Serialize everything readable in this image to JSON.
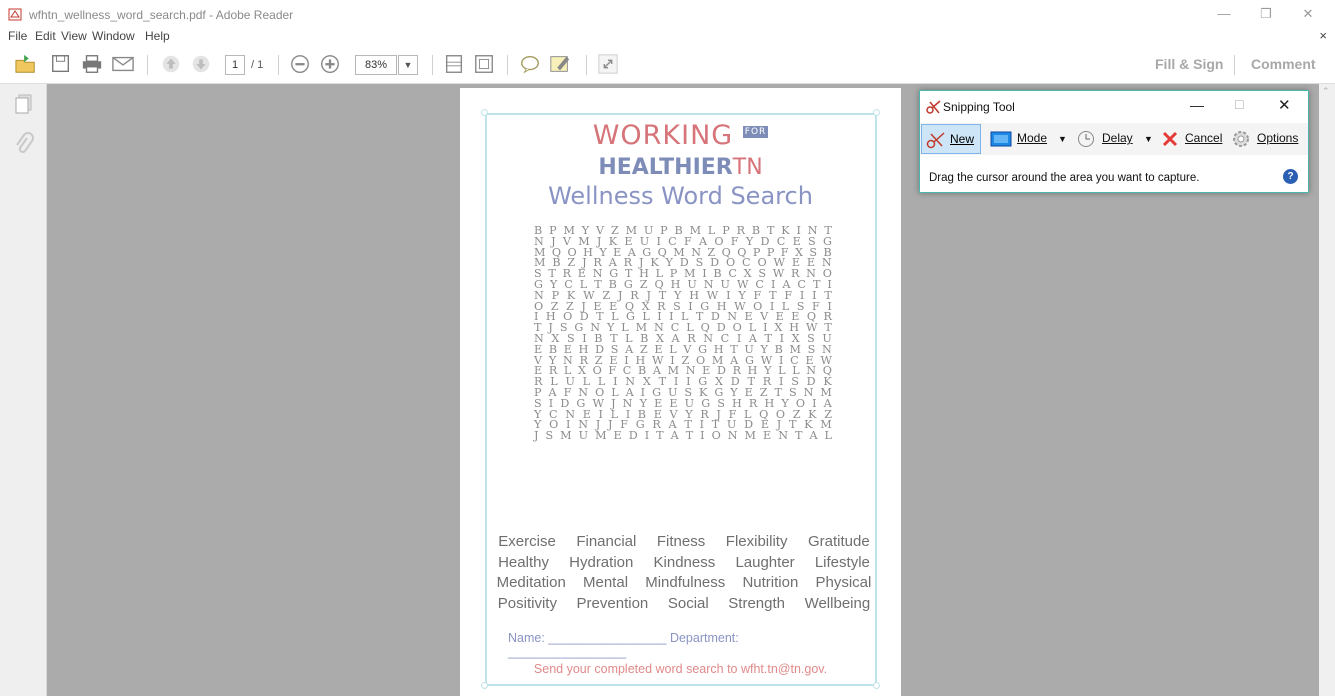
{
  "window": {
    "title": "wfhtn_wellness_word_search.pdf - Adobe Reader"
  },
  "menu": {
    "items": [
      "File",
      "Edit",
      "View",
      "Window",
      "Help"
    ],
    "close": "×"
  },
  "toolbar": {
    "page_current": "1",
    "page_total": "/ 1",
    "zoom": "83%",
    "fill_sign": "Fill & Sign",
    "comment": "Comment"
  },
  "document": {
    "logo_line1": "WORKING",
    "logo_badge": "FOR",
    "logo_line2a": "HEALTHIER",
    "logo_line2b": "TN",
    "title": "Wellness Word Search",
    "grid": [
      "BPMYVZMUPBMLPRBTKINT",
      "NJVMJKEUICFAOFYDCESG",
      "MQOHYEAGQMNZQQPPFXSB",
      "MBZJRARJKYDSDOCOWEEN",
      "STRENGTHLPMIBCXSWRNO",
      "GYCLTBGZQHUNUWCIACTI",
      "NPKWZJRJTYHWIYFTFIIT",
      "OZZJEEQXRSIGHWOILSFI",
      "IHODTLGLIILTDNEVEEQR",
      "TJSGNYLMNCLQDOLIXHWT",
      "NXSIBTLBXARNCIATIXSU",
      "EBEHDSAZELVGHTUYBMSN",
      "VYNRZEIHWIZOMAGWICEW",
      "ERLXOFCBAMNEDRHYLLNQ",
      "RLULLINXTIIGXDTRISDK",
      "PAFNOLAIGUSKGYEZTSNM",
      "SIDGWJNYEEUGSHRHYOIA",
      "YCNEILIBEVYRJFLQOZKZ",
      "YOINJJFGRATITUDEJTKM",
      "JSMUMEDITATIONMENTAL"
    ],
    "words": [
      [
        "Exercise",
        "Financial",
        "Fitness",
        "Flexibility",
        "Gratitude"
      ],
      [
        "Healthy",
        "Hydration",
        "Kindness",
        "Laughter",
        "Lifestyle"
      ],
      [
        "Meditation",
        "Mental",
        "Mindfulness",
        "Nutrition",
        "Physical"
      ],
      [
        "Positivity",
        "Prevention",
        "Social",
        "Strength",
        "Wellbeing"
      ]
    ],
    "name_line": "Name: _________________ Department: _________________",
    "send_line": "Send your completed word search to wfht.tn@tn.gov."
  },
  "snipping_tool": {
    "title": "Snipping Tool",
    "new": "New",
    "mode": "Mode",
    "delay": "Delay",
    "cancel": "Cancel",
    "options": "Options",
    "message": "Drag the cursor around the area you want to capture.",
    "help": "?"
  }
}
